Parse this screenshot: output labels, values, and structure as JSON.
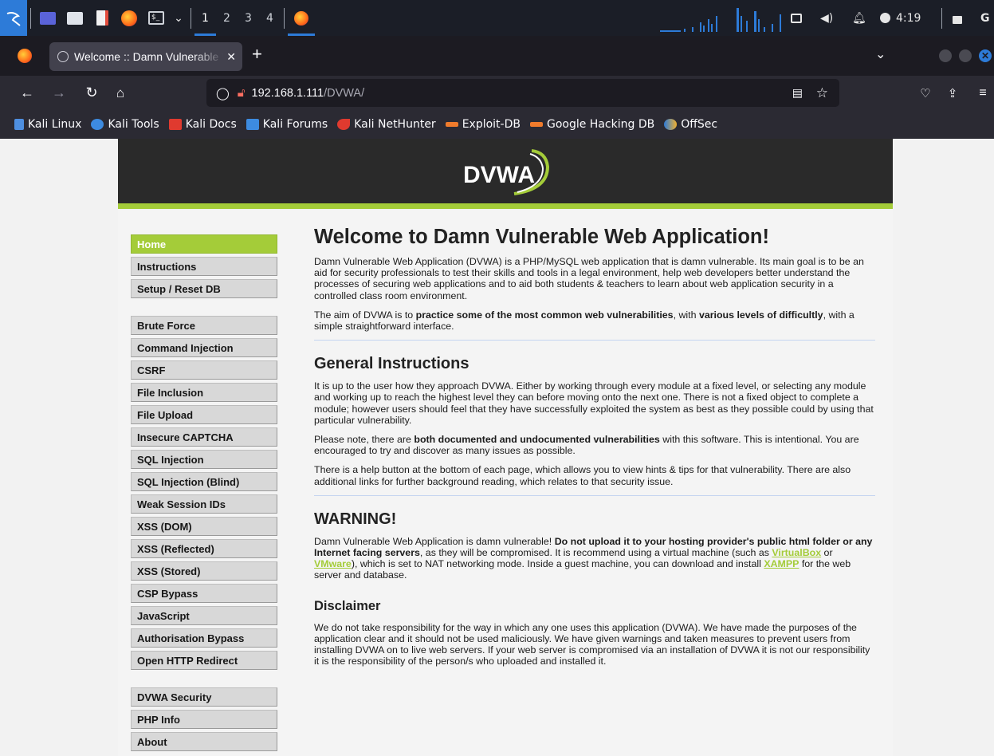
{
  "panel": {
    "workspaces": [
      "1",
      "2",
      "3",
      "4"
    ],
    "clock": "4:19",
    "letter": "G"
  },
  "browser": {
    "tab_title": "Welcome :: Damn Vulnerable Web Application",
    "url_host": "192.168.1.111",
    "url_path": "/DVWA/",
    "bookmarks": [
      "Kali Linux",
      "Kali Tools",
      "Kali Docs",
      "Kali Forums",
      "Kali NetHunter",
      "Exploit-DB",
      "Google Hacking DB",
      "OffSec"
    ]
  },
  "site": {
    "logo_text": "DVWA",
    "menu_group1": [
      "Home",
      "Instructions",
      "Setup / Reset DB"
    ],
    "menu_group2": [
      "Brute Force",
      "Command Injection",
      "CSRF",
      "File Inclusion",
      "File Upload",
      "Insecure CAPTCHA",
      "SQL Injection",
      "SQL Injection (Blind)",
      "Weak Session IDs",
      "XSS (DOM)",
      "XSS (Reflected)",
      "XSS (Stored)",
      "CSP Bypass",
      "JavaScript",
      "Authorisation Bypass",
      "Open HTTP Redirect"
    ],
    "menu_group3": [
      "DVWA Security",
      "PHP Info",
      "About"
    ]
  },
  "content": {
    "title": "Welcome to Damn Vulnerable Web Application!",
    "intro": "Damn Vulnerable Web Application (DVWA) is a PHP/MySQL web application that is damn vulnerable. Its main goal is to be an aid for security professionals to test their skills and tools in a legal environment, help web developers better understand the processes of securing web applications and to aid both students & teachers to learn about web application security in a controlled class room environment.",
    "aim_1": "The aim of DVWA is to ",
    "aim_b1": "practice some of the most common web vulnerabilities",
    "aim_2": ", with ",
    "aim_b2": "various levels of difficultly",
    "aim_3": ", with a simple straightforward interface.",
    "gi_title": "General Instructions",
    "gi_p1": "It is up to the user how they approach DVWA. Either by working through every module at a fixed level, or selecting any module and working up to reach the highest level they can before moving onto the next one. There is not a fixed object to complete a module; however users should feel that they have successfully exploited the system as best as they possible could by using that particular vulnerability.",
    "gi_p2_a": "Please note, there are ",
    "gi_p2_b": "both documented and undocumented vulnerabilities",
    "gi_p2_c": " with this software. This is intentional. You are encouraged to try and discover as many issues as possible.",
    "gi_p3": "There is a help button at the bottom of each page, which allows you to view hints & tips for that vulnerability. There are also additional links for further background reading, which relates to that security issue.",
    "warn_title": "WARNING!",
    "warn_a": "Damn Vulnerable Web Application is damn vulnerable! ",
    "warn_b": "Do not upload it to your hosting provider's public html folder or any Internet facing servers",
    "warn_c": ", as they will be compromised. It is recommend using a virtual machine (such as ",
    "link_vbox": "VirtualBox",
    "warn_or": " or ",
    "link_vmware": "VMware",
    "warn_d": "), which is set to NAT networking mode. Inside a guest machine, you can download and install ",
    "link_xampp": "XAMPP",
    "warn_e": " for the web server and database.",
    "disc_title": "Disclaimer",
    "disc_p": "We do not take responsibility for the way in which any one uses this application (DVWA). We have made the purposes of the application clear and it should not be used maliciously. We have given warnings and taken measures to prevent users from installing DVWA on to live web servers. If your web server is compromised via an installation of DVWA it is not our responsibility it is the responsibility of the person/s who uploaded and installed it."
  },
  "colors": {
    "accent": "#a4cc39",
    "header": "#2a2a2a",
    "panel": "#1b1e27"
  }
}
